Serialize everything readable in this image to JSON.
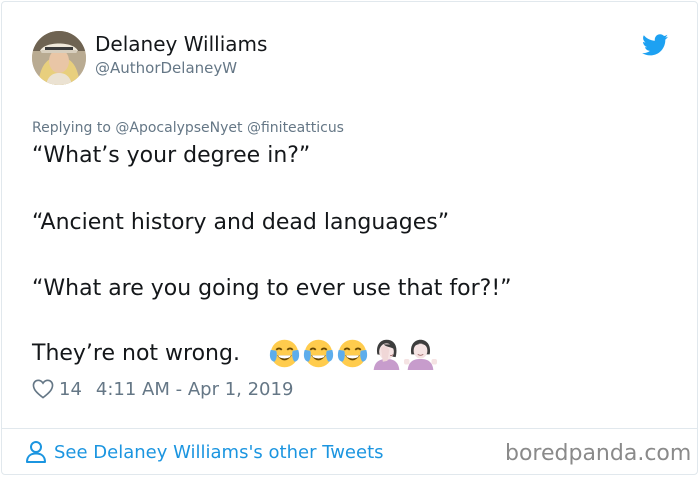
{
  "author": {
    "name": "Delaney Williams",
    "handle": "@AuthorDelaneyW"
  },
  "reply": {
    "prefix": "Replying to",
    "handles": [
      "@ApocalypseNyet",
      "@finiteatticus"
    ]
  },
  "tweet": {
    "lines": [
      "“What’s your degree in?”",
      "“Ancient history and dead languages”",
      "“What are you going to ever use that for?!”",
      "They’re not wrong."
    ],
    "emojis": [
      "face-with-tears-of-joy",
      "face-with-tears-of-joy",
      "face-with-tears-of-joy",
      "woman-facepalming",
      "woman-shrugging"
    ]
  },
  "meta": {
    "likes": "14",
    "timestamp": "4:11 AM - Apr 1, 2019"
  },
  "footer": {
    "see_more": "See Delaney Williams's other Tweets",
    "watermark": "boredpanda.com"
  },
  "colors": {
    "link": "#1b95e0",
    "muted": "#657786",
    "twitter": "#1da1f2"
  }
}
